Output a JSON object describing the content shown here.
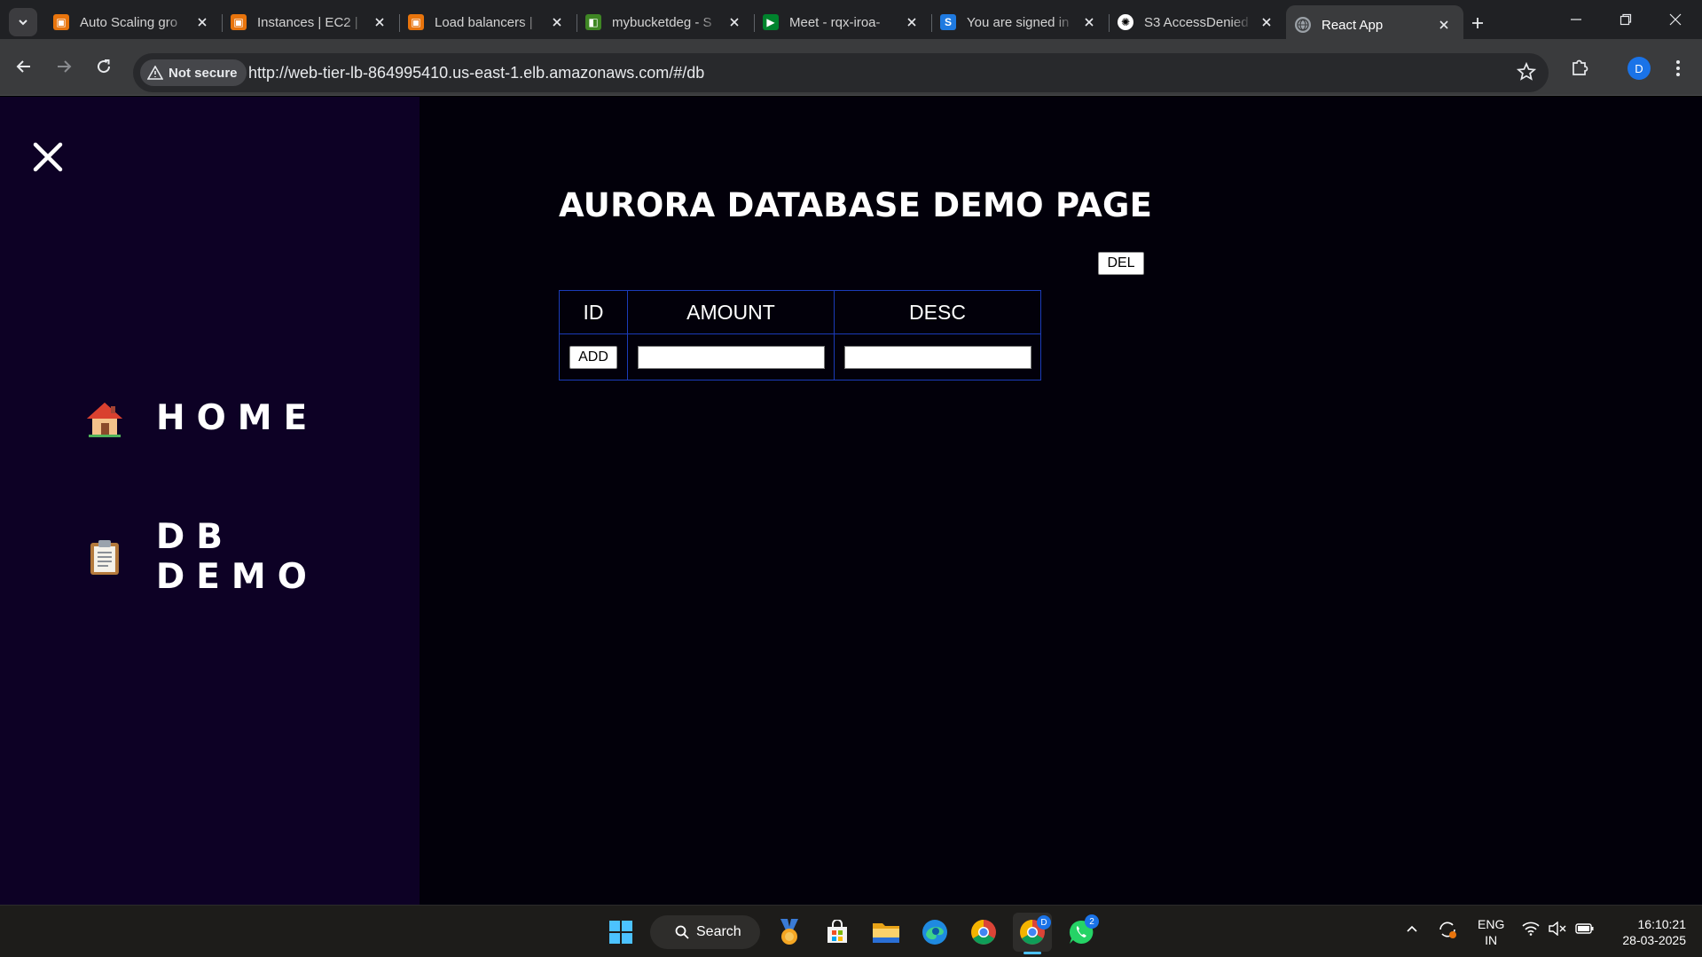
{
  "browser": {
    "tabs": [
      {
        "title": "Auto Scaling gro",
        "favicon": "aws-ec2-icon",
        "color": "#e8740c"
      },
      {
        "title": "Instances | EC2 |",
        "favicon": "aws-ec2-icon",
        "color": "#e8740c"
      },
      {
        "title": "Load balancers |",
        "favicon": "aws-ec2-icon",
        "color": "#e8740c"
      },
      {
        "title": "mybucketdeg - S",
        "favicon": "aws-s3-icon",
        "color": "#3f8624"
      },
      {
        "title": "Meet - rqx-iroa-",
        "favicon": "google-meet-icon",
        "color": "#00832d"
      },
      {
        "title": "You are signed in",
        "favicon": "s-logo-icon",
        "color": "#1f7ae0"
      },
      {
        "title": "S3 AccessDenied",
        "favicon": "openai-icon",
        "color": "#ffffff"
      },
      {
        "title": "React App",
        "favicon": "globe-icon",
        "color": "#9aa0a6",
        "active": true
      }
    ],
    "security_label": "Not secure",
    "url": "http://web-tier-lb-864995410.us-east-1.elb.amazonaws.com/#/db",
    "profile_initial": "D"
  },
  "sidebar": {
    "items": [
      {
        "label": "HOME",
        "icon": "house-icon"
      },
      {
        "label": "DB DEMO",
        "icon": "clipboard-icon"
      }
    ]
  },
  "main": {
    "title": "AURORA DATABASE DEMO PAGE",
    "del_label": "DEL",
    "table": {
      "headers": [
        "ID",
        "AMOUNT",
        "DESC"
      ],
      "add_label": "ADD",
      "amount_value": "",
      "desc_value": ""
    }
  },
  "taskbar": {
    "search_label": "Search",
    "chrome_badge": "D",
    "whatsapp_badge": "2",
    "lang_line1": "ENG",
    "lang_line2": "IN",
    "time": "16:10:21",
    "date": "28-03-2025"
  },
  "colors": {
    "sidebar_bg": "#0d0125",
    "page_bg": "#02000a",
    "table_border": "#1b3bb8"
  }
}
